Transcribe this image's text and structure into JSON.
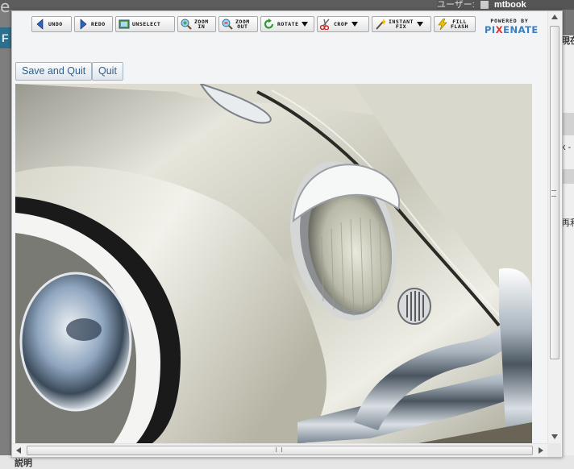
{
  "background": {
    "user_label": "ユーザー:",
    "username": "mtbook",
    "logo_fragment": "e",
    "blue_strip_letter": "F",
    "right_column_texts": [
      "現在",
      "k -",
      "再利用"
    ],
    "bottom_label": "説明"
  },
  "toolbar": {
    "buttons": [
      {
        "label": "UNDO",
        "icon": "undo-icon"
      },
      {
        "label": "REDO",
        "icon": "redo-icon"
      },
      {
        "label": "UNSELECT",
        "icon": "unselect-icon"
      },
      {
        "label": "ZOOM\nIN",
        "icon": "zoom-in-icon"
      },
      {
        "label": "ZOOM\nOUT",
        "icon": "zoom-out-icon"
      },
      {
        "label": "ROTATE",
        "icon": "rotate-icon",
        "dropdown": true
      },
      {
        "label": "CROP",
        "icon": "crop-icon",
        "dropdown": true
      },
      {
        "label": "INSTANT\nFIX",
        "icon": "instant-fix-icon",
        "dropdown": true
      },
      {
        "label": "FILL\nFLASH",
        "icon": "fill-flash-icon"
      }
    ],
    "powered_by": "POWERED BY",
    "brand_left": "PI",
    "brand_x": "X",
    "brand_right": "ENATE"
  },
  "actions": {
    "save_and_quit": "Save and Quit",
    "quit": "Quit"
  },
  "colors": {
    "link_blue": "#2f5f8f",
    "brand_blue": "#3a7fc0",
    "brand_red": "#d33333"
  }
}
